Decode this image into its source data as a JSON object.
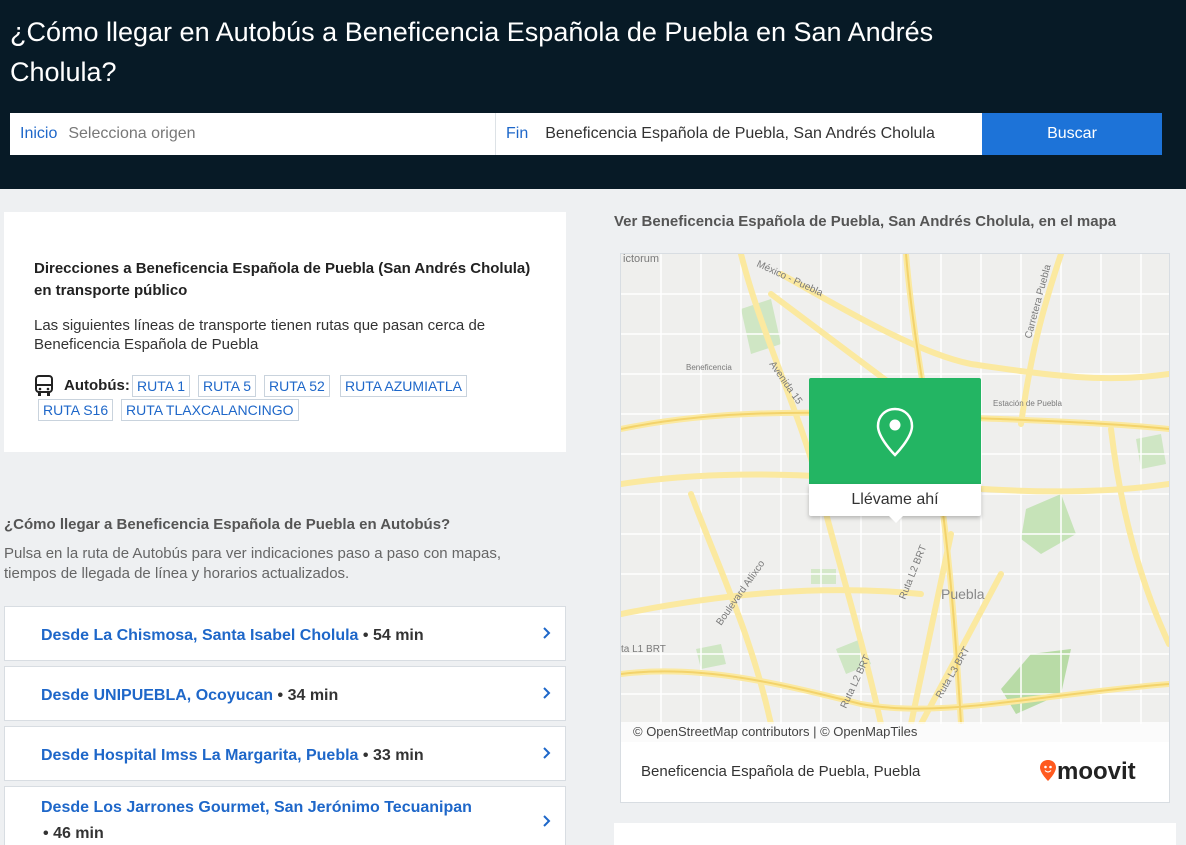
{
  "header": {
    "title": "¿Cómo llegar en Autobús a Beneficencia Española de Puebla en San Andrés Cholula?"
  },
  "search": {
    "origin_label": "Inicio",
    "origin_placeholder": "Selecciona origen",
    "dest_label": "Fin",
    "dest_value": "Beneficencia Española de Puebla, San Andrés Cholula",
    "button_label": "Buscar"
  },
  "info_card": {
    "title": "Direcciones a Beneficencia Española de Puebla (San Andrés Cholula) en transporte público",
    "text": "Las siguientes líneas de transporte tienen rutas que pasan cerca de Beneficencia Española de Puebla",
    "bus_label": "Autobús:",
    "routes": [
      "RUTA 1",
      "RUTA 5",
      "RUTA 52",
      "RUTA AZUMIATLA",
      "RUTA S16",
      "RUTA TLAXCALANCINGO"
    ]
  },
  "section": {
    "title": "¿Cómo llegar a Beneficencia Española de Puebla en Autobús?",
    "text": "Pulsa en la ruta de Autobús para ver indicaciones paso a paso con mapas, tiempos de llegada de línea y horarios actualizados."
  },
  "route_list": [
    {
      "name": "Desde La Chismosa, Santa Isabel Cholula",
      "sep": "•",
      "time": "54 min"
    },
    {
      "name": "Desde UNIPUEBLA, Ocoyucan",
      "sep": "•",
      "time": "34 min"
    },
    {
      "name": "Desde Hospital Imss La Margarita, Puebla",
      "sep": "•",
      "time": "33 min"
    },
    {
      "name": "Desde Los Jarrones Gourmet, San Jerónimo Tecuanipan",
      "sep": "•",
      "time": "46 min"
    }
  ],
  "map": {
    "heading": "Ver Beneficencia Española de Puebla, San Andrés Cholula, en el mapa",
    "popup_label": "Llévame ahí",
    "attribution": "© OpenStreetMap contributors | © OpenMapTiles",
    "footer_text": "Beneficencia Española de Puebla, Puebla",
    "brand": "moovit",
    "labels": {
      "victorum": "ictorum",
      "mexico_puebla": "México - Puebla",
      "carretera_puebla": "Carretera Puebla",
      "beneficencia": "Beneficencia",
      "avenida": "Avenida 15",
      "estacion": "Estación de Puebla",
      "boulevard": "Boulevard Atlixco",
      "ruta_l2_a": "Ruta L2 BRT",
      "ruta_l2_b": "Ruta L2 BRT",
      "ruta_l3": "Ruta L3 BRT",
      "ruta_l1": "ta L1 BRT",
      "puebla": "Puebla"
    }
  },
  "colors": {
    "header_bg": "#071a26",
    "accent_blue": "#1d73d8",
    "link_blue": "#1e67c9",
    "popup_green": "#23b563",
    "moovit_orange": "#ff5a1f"
  }
}
